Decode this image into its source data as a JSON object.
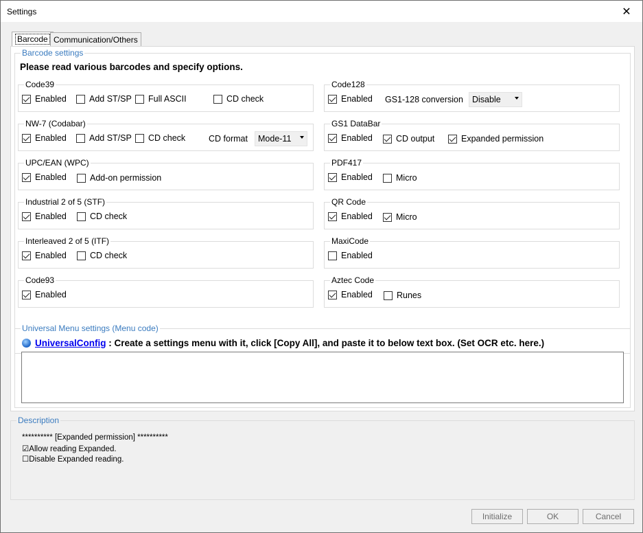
{
  "window": {
    "title": "Settings"
  },
  "tabs": [
    {
      "label": "Barcode",
      "active": true
    },
    {
      "label": "Communication/Others",
      "active": false
    }
  ],
  "barcode_settings": {
    "group_title": "Barcode settings",
    "heading": "Please read various barcodes and specify options.",
    "groups": {
      "code39": {
        "title": "Code39",
        "options": [
          {
            "label": "Enabled",
            "checked": true
          },
          {
            "label": "Add ST/SP",
            "checked": false
          },
          {
            "label": "Full ASCII",
            "checked": false
          },
          {
            "label": "CD check",
            "checked": false
          }
        ]
      },
      "nw7": {
        "title": "NW-7 (Codabar)",
        "options": [
          {
            "label": "Enabled",
            "checked": true
          },
          {
            "label": "Add ST/SP",
            "checked": false
          },
          {
            "label": "CD check",
            "checked": false
          }
        ],
        "cd_format_label": "CD format",
        "cd_format_value": "Mode-11"
      },
      "upc": {
        "title": "UPC/EAN (WPC)",
        "options": [
          {
            "label": "Enabled",
            "checked": true
          },
          {
            "label": "Add-on permission",
            "checked": false
          }
        ]
      },
      "ind25": {
        "title": "Industrial 2 of 5 (STF)",
        "options": [
          {
            "label": "Enabled",
            "checked": true
          },
          {
            "label": "CD check",
            "checked": false
          }
        ]
      },
      "itf": {
        "title": "Interleaved 2 of 5 (ITF)",
        "options": [
          {
            "label": "Enabled",
            "checked": true
          },
          {
            "label": "CD check",
            "checked": false
          }
        ]
      },
      "code93": {
        "title": "Code93",
        "options": [
          {
            "label": "Enabled",
            "checked": true
          }
        ]
      },
      "code128": {
        "title": "Code128",
        "options": [
          {
            "label": "Enabled",
            "checked": true
          }
        ],
        "gs1_label": "GS1-128 conversion",
        "gs1_value": "Disable"
      },
      "gs1databar": {
        "title": "GS1 DataBar",
        "options": [
          {
            "label": "Enabled",
            "checked": true
          },
          {
            "label": "CD output",
            "checked": true
          },
          {
            "label": "Expanded permission",
            "checked": true
          }
        ]
      },
      "pdf417": {
        "title": "PDF417",
        "options": [
          {
            "label": "Enabled",
            "checked": true
          },
          {
            "label": "Micro",
            "checked": false
          }
        ]
      },
      "qr": {
        "title": "QR Code",
        "options": [
          {
            "label": "Enabled",
            "checked": true
          },
          {
            "label": "Micro",
            "checked": true
          }
        ]
      },
      "maxi": {
        "title": "MaxiCode",
        "options": [
          {
            "label": "Enabled",
            "checked": false
          }
        ]
      },
      "aztec": {
        "title": "Aztec Code",
        "options": [
          {
            "label": "Enabled",
            "checked": true
          },
          {
            "label": "Runes",
            "checked": false
          }
        ]
      }
    }
  },
  "universal_menu": {
    "group_title": "Universal Menu settings (Menu code)",
    "link_text": "UniversalConfig",
    "instruction": " : Create a settings menu with it, click [Copy All], and paste it to below text box. (Set OCR etc. here.)",
    "text_value": ""
  },
  "description": {
    "title": "Description",
    "lines": [
      "**********  [Expanded permission]  **********",
      "☑Allow reading Expanded.",
      "☐Disable Expanded reading."
    ]
  },
  "buttons": {
    "initialize": "Initialize",
    "ok": "OK",
    "cancel": "Cancel"
  },
  "colors": {
    "group_title_blue": "#3a7bbf",
    "link": "#0000ee",
    "disabled_text": "#6d6d6d"
  }
}
